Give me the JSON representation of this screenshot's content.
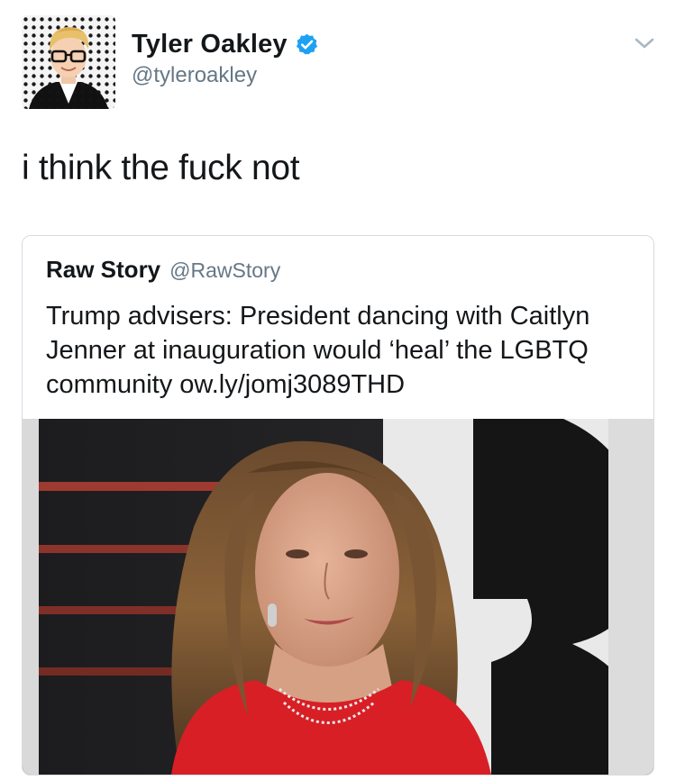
{
  "tweet": {
    "author": {
      "name": "Tyler Oakley",
      "handle": "@tyleroakley",
      "verified": true
    },
    "text": "i think the fuck not"
  },
  "quoted_tweet": {
    "author": {
      "name": "Raw Story",
      "handle": "@RawStory"
    },
    "text": "Trump advisers: President dancing with Caitlyn Jenner at inauguration would ‘heal’ the LGBTQ community ow.ly/jomj3089THD"
  },
  "icons": {
    "verified": "verified-badge-icon",
    "menu": "chevron-down-icon"
  },
  "colors": {
    "text_primary": "#14171a",
    "text_secondary": "#657786",
    "verified_blue": "#1da1f2",
    "border": "#d6dde3"
  }
}
